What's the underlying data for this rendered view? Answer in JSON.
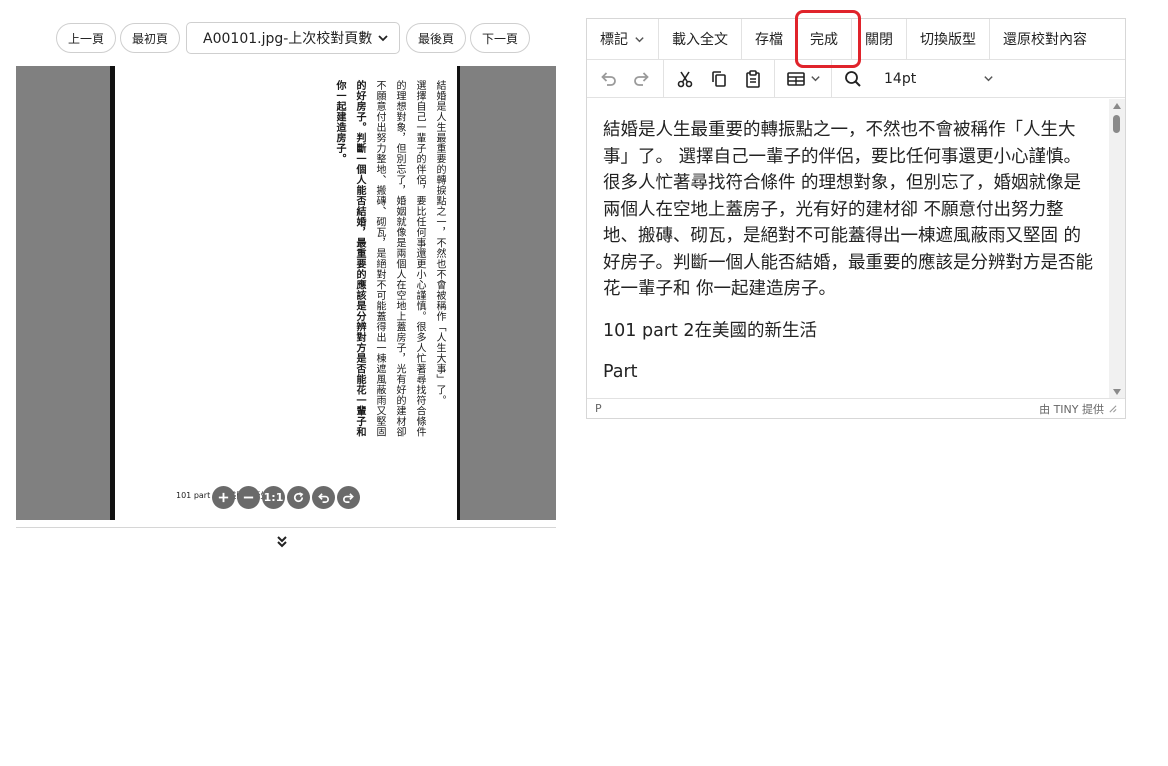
{
  "nav": {
    "prev_label": "上一頁",
    "first_label": "最初頁",
    "page_select_value": "A00101.jpg-上次校對頁數",
    "last_label": "最後頁",
    "next_label": "下一頁"
  },
  "scan": {
    "columns": [
      "結婚是人生最重要的轉捩點之一，不然也不會被稱作「人生大事」了。",
      "選擇自己一輩子的伴侶，要比任何事還更小心謹慎。很多人忙著尋找符合條件",
      "的理想對象，但別忘了，婚姻就像是兩個人在空地上蓋房子，光有好的建材卻",
      "不願意付出努力整地、搬磚、砌瓦，是絕對不可能蓋得出一棟遮風蔽雨又堅固",
      "的好房子。判斷一個人能否結婚，最重要的應該是分辨對方是否能花一輩子和",
      "你一起建造房子。"
    ],
    "footer": "101   part 2 在美國的新生活",
    "zoom_reset_label": "1:1"
  },
  "editor": {
    "menu": [
      "標記",
      "載入全文",
      "存檔",
      "完成",
      "關閉",
      "切換版型",
      "還原校對內容"
    ],
    "font_size": "14pt",
    "paragraphs": [
      "結婚是人生最重要的轉振點之一，不然也不會被稱作「人生大事」了。 選擇自己一輩子的伴侶，要比任何事還更小心謹慎。很多人忙著尋找符合條件 的理想對象，但別忘了，婚姻就像是兩個人在空地上蓋房子，光有好的建材卻 不願意付出努力整地、搬磚、砌瓦，是絕對不可能蓋得出一棟遮風蔽雨又堅固 的好房子。判斷一個人能否結婚，最重要的應該是分辨對方是否能花一輩子和 你一起建造房子。",
      "101 part 2在美國的新生活",
      "Part"
    ],
    "status_path": "P",
    "status_brand": "由 TINY 提供"
  },
  "colors": {
    "highlight": "#e0232b",
    "viewer_bg": "#808080"
  }
}
